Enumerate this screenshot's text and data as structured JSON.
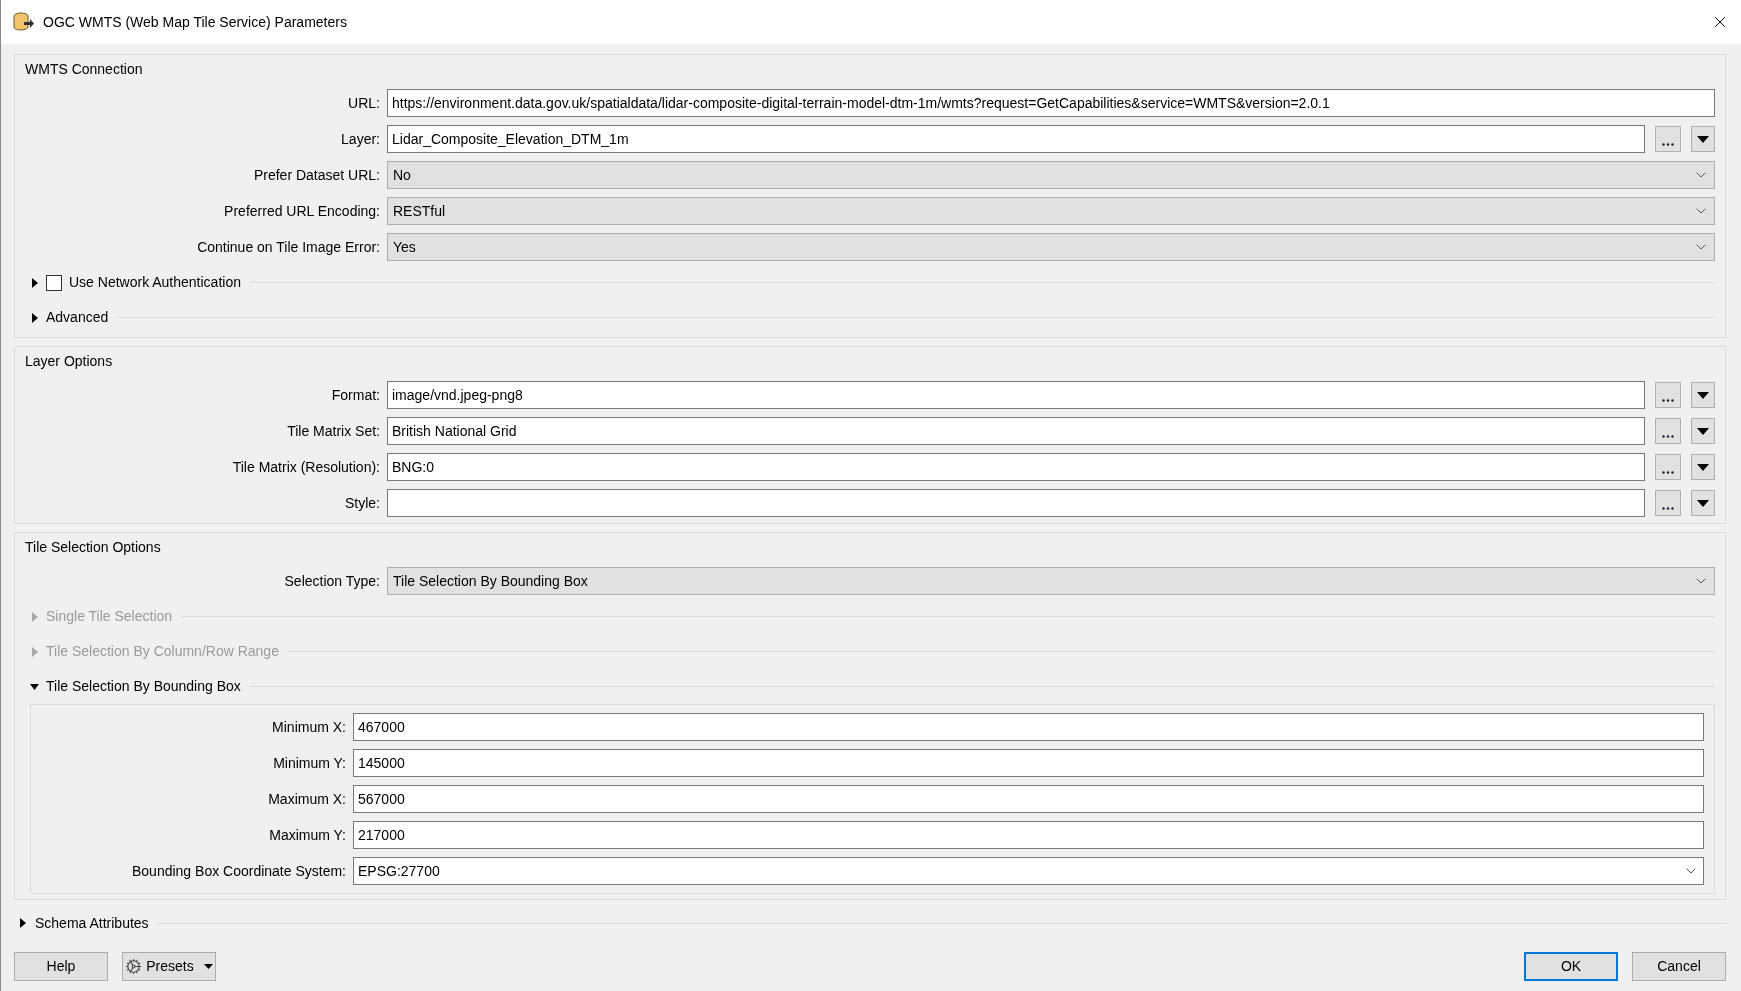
{
  "window": {
    "title": "OGC WMTS (Web Map Tile Service) Parameters"
  },
  "sections": [
    {
      "title": "WMTS Connection",
      "rows": [
        {
          "kind": "text",
          "label": "URL:",
          "value": "https://environment.data.gov.uk/spatialdata/lidar-composite-digital-terrain-model-dtm-1m/wmts?request=GetCapabilities&service=WMTS&version=2.0.1"
        },
        {
          "kind": "picker",
          "label": "Layer:",
          "value": "Lidar_Composite_Elevation_DTM_1m"
        },
        {
          "kind": "select",
          "label": "Prefer Dataset URL:",
          "value": "No"
        },
        {
          "kind": "select",
          "label": "Preferred URL Encoding:",
          "value": "RESTful"
        },
        {
          "kind": "select",
          "label": "Continue on Tile Image Error:",
          "value": "Yes"
        },
        {
          "kind": "collapsible",
          "label": "Use Network Authentication",
          "expanded": false,
          "disabled": false,
          "checkbox": {
            "checked": false
          }
        },
        {
          "kind": "collapsible",
          "label": "Advanced",
          "expanded": false,
          "disabled": false
        }
      ]
    },
    {
      "title": "Layer Options",
      "rows": [
        {
          "kind": "picker",
          "label": "Format:",
          "value": "image/vnd.jpeg-png8"
        },
        {
          "kind": "picker",
          "label": "Tile Matrix Set:",
          "value": "British National Grid"
        },
        {
          "kind": "picker",
          "label": "Tile Matrix (Resolution):",
          "value": "BNG:0"
        },
        {
          "kind": "picker",
          "label": "Style:",
          "value": ""
        }
      ]
    },
    {
      "title": "Tile Selection Options",
      "rows": [
        {
          "kind": "select",
          "label": "Selection Type:",
          "value": "Tile Selection By Bounding Box"
        },
        {
          "kind": "collapsible",
          "label": "Single Tile Selection",
          "expanded": false,
          "disabled": true
        },
        {
          "kind": "collapsible",
          "label": "Tile Selection By Column/Row Range",
          "expanded": false,
          "disabled": true
        },
        {
          "kind": "collapsible",
          "label": "Tile Selection By Bounding Box",
          "expanded": true,
          "disabled": false,
          "children": [
            {
              "kind": "text",
              "label": "Minimum X:",
              "value": "467000"
            },
            {
              "kind": "text",
              "label": "Minimum Y:",
              "value": "145000"
            },
            {
              "kind": "text",
              "label": "Maximum X:",
              "value": "567000"
            },
            {
              "kind": "text",
              "label": "Maximum Y:",
              "value": "217000"
            },
            {
              "kind": "combo",
              "label": "Bounding Box Coordinate System:",
              "value": "EPSG:27700"
            }
          ]
        }
      ]
    }
  ],
  "schema": {
    "label": "Schema Attributes",
    "expanded": false
  },
  "footer": {
    "left": [
      {
        "kind": "plain",
        "label": "Help",
        "default": false
      },
      {
        "kind": "menu",
        "label": "Presets",
        "default": false
      }
    ],
    "right": [
      {
        "kind": "plain",
        "label": "OK",
        "default": true
      },
      {
        "kind": "plain",
        "label": "Cancel",
        "default": false
      }
    ]
  }
}
